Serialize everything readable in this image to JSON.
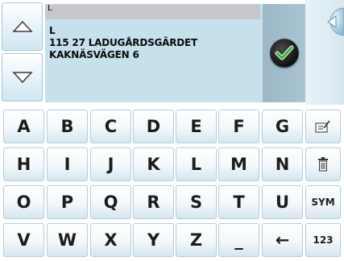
{
  "address": {
    "input_value": "L",
    "lines": [
      "L",
      "115 27 LADUGÅRDSGÄRDET",
      "KAKNÄSVÄGEN 6"
    ]
  },
  "nav": {
    "scroll_up_icon": "up-triangle-icon",
    "scroll_down_icon": "down-triangle-icon",
    "confirm_icon": "checkmark-icon",
    "back_icon": "back-arrow-icon"
  },
  "keyboard": {
    "row1": [
      "A",
      "B",
      "C",
      "D",
      "E",
      "F",
      "G"
    ],
    "row2": [
      "H",
      "I",
      "J",
      "K",
      "L",
      "M",
      "N"
    ],
    "row3": [
      "O",
      "P",
      "Q",
      "R",
      "S",
      "T",
      "U"
    ],
    "row4": [
      "V",
      "W",
      "X",
      "Y",
      "Z",
      "_",
      "←"
    ],
    "side": {
      "edit_icon": "edit-icon",
      "delete_icon": "trash-icon",
      "sym_label": "SYM",
      "num_label": "123"
    }
  },
  "colors": {
    "panel_bg": "#c6e0ec",
    "input_bg": "#c7c8cb",
    "check_green": "#2fb52f"
  }
}
